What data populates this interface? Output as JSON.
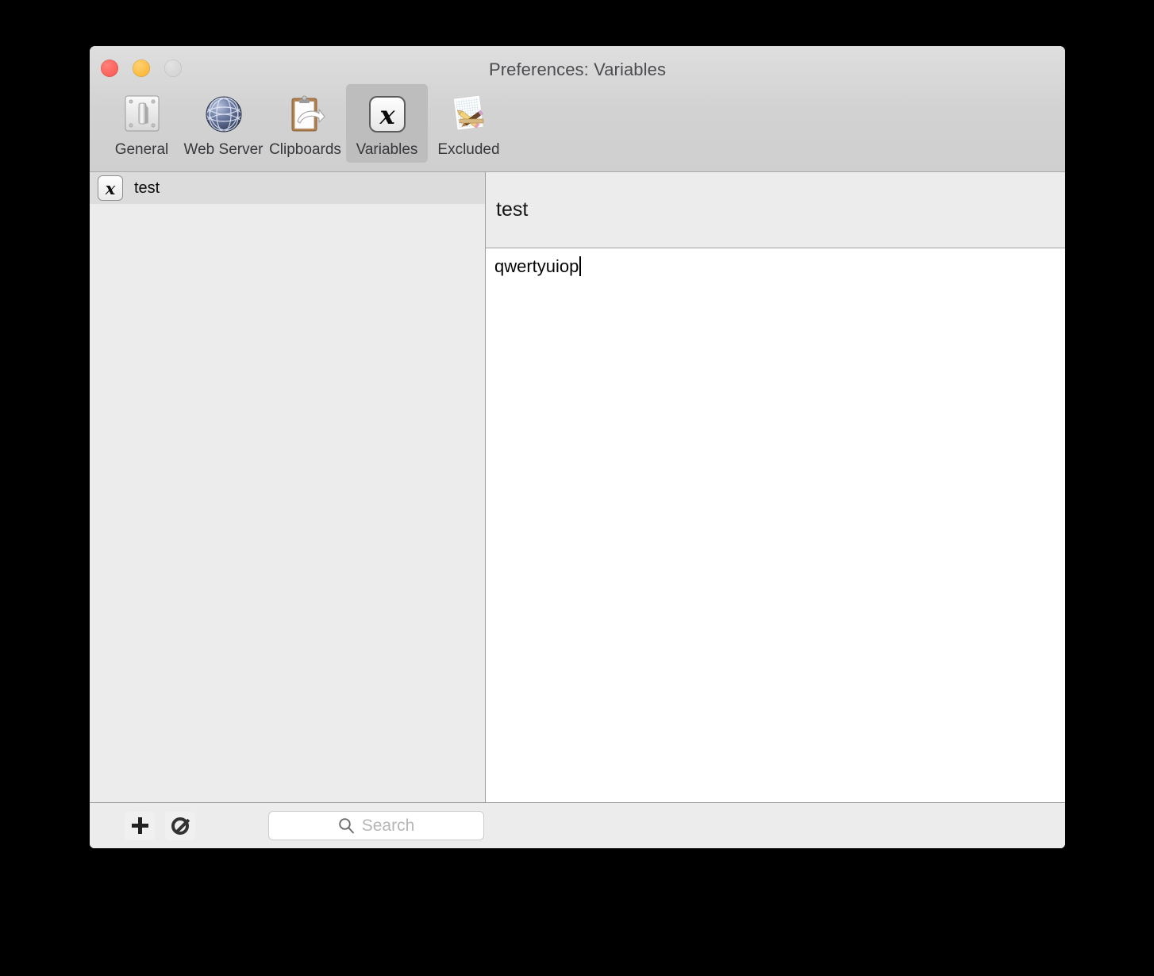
{
  "window": {
    "title": "Preferences: Variables",
    "traffic_lights": [
      {
        "name": "close",
        "color": "#f9524c"
      },
      {
        "name": "minimize",
        "color": "#f7b125"
      },
      {
        "name": "zoom",
        "color": "#cfcfcf"
      }
    ]
  },
  "toolbar": {
    "items": [
      {
        "label": "General",
        "icon": "light-switch-icon",
        "selected": false
      },
      {
        "label": "Web Server",
        "icon": "globe-icon",
        "selected": false
      },
      {
        "label": "Clipboards",
        "icon": "clipboard-arrow-icon",
        "selected": false
      },
      {
        "label": "Variables",
        "icon": "script-x-icon",
        "selected": true
      },
      {
        "label": "Excluded",
        "icon": "graph-paper-pencil-icon",
        "selected": false
      }
    ]
  },
  "sidebar": {
    "items": [
      {
        "label": "test",
        "icon": "script-x-icon",
        "selected": true
      }
    ]
  },
  "detail": {
    "name": "test",
    "value": "qwertyuiop",
    "caret_visible": true
  },
  "bottom_bar": {
    "add_button": {
      "name": "add-variable-button",
      "icon": "plus-icon"
    },
    "delete_button": {
      "name": "delete-variable-button",
      "icon": "prohibited-icon"
    },
    "search": {
      "placeholder": "Search",
      "value": "",
      "icon": "search-icon"
    }
  },
  "colors": {
    "titlebar_top": "#dedede",
    "titlebar_bottom": "#cfcfcf",
    "panel_bg": "#ececec",
    "selected_toolbar": "#bdbdbd",
    "selected_row": "#dcdcdc",
    "content_bg": "#ffffff",
    "divider": "#9b9b9b"
  }
}
